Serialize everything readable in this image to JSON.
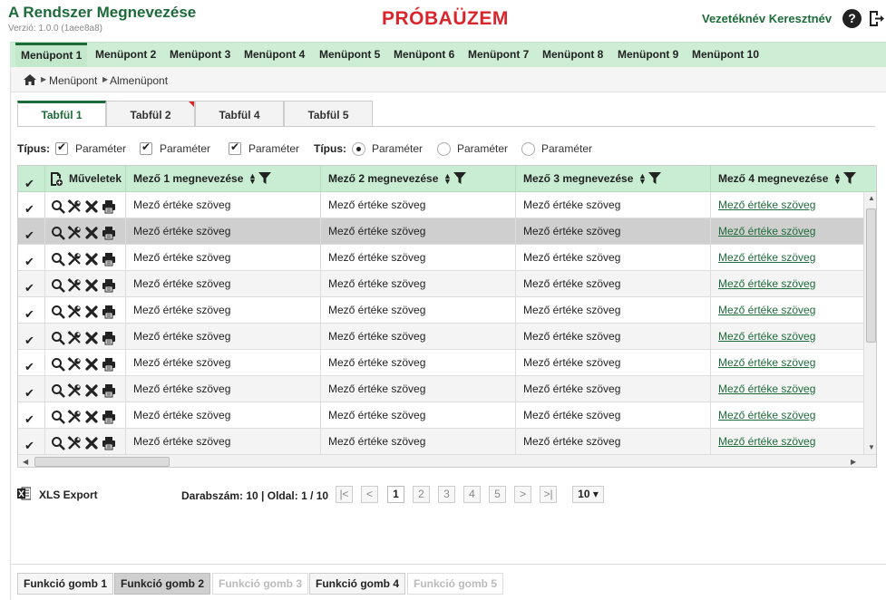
{
  "app": {
    "title": "A Rendszer Megnevezése",
    "version": "Verzió: 1.0.0 (1aee8a8)",
    "environment": "PRÓBAÜZEM",
    "user": "Vezetéknév Keresztnév",
    "help_label": "?",
    "accent_color": "#1d6b3a",
    "env_color": "#d9262c"
  },
  "menu": [
    "Menüpont 1",
    "Menüpont 2",
    "Menüpont 3",
    "Menüpont 4",
    "Menüpont 5",
    "Menüpont 6",
    "Menüpont 7",
    "Menüpont 8",
    "Menüpont 9",
    "Menüpont 10"
  ],
  "breadcrumb": [
    "Menüpont",
    "Almenüpont"
  ],
  "tabs": [
    "Tabfül 1",
    "Tabfül 2",
    "Tabfül 4",
    "Tabfül 5"
  ],
  "filters": {
    "label1": "Típus:",
    "checkboxes": [
      "Paraméter",
      "Paraméter",
      "Paraméter"
    ],
    "label2": "Típus:",
    "radios": [
      "Paraméter",
      "Paraméter",
      "Paraméter"
    ]
  },
  "grid": {
    "actions_header": "Műveletek",
    "columns": [
      "Mező 1 megnevezése",
      "Mező 2 megnevezése",
      "Mező 3 megnevezése",
      "Mező 4 megnevezése"
    ],
    "cell_value": "Mező értéke szöveg",
    "rows": 10
  },
  "footer": {
    "export": "XLS Export",
    "count": "Darabszám: 10 | Oldal: 1 / 10",
    "first": "|<",
    "prev": "<",
    "pages": [
      "1",
      "2",
      "3",
      "4",
      "5"
    ],
    "next": ">",
    "last": ">|",
    "page_size": "10 ▾"
  },
  "functions": [
    "Funkció gomb 1",
    "Funkció gomb 2",
    "Funkció gomb 3",
    "Funkció gomb 4",
    "Funkció gomb 5"
  ]
}
